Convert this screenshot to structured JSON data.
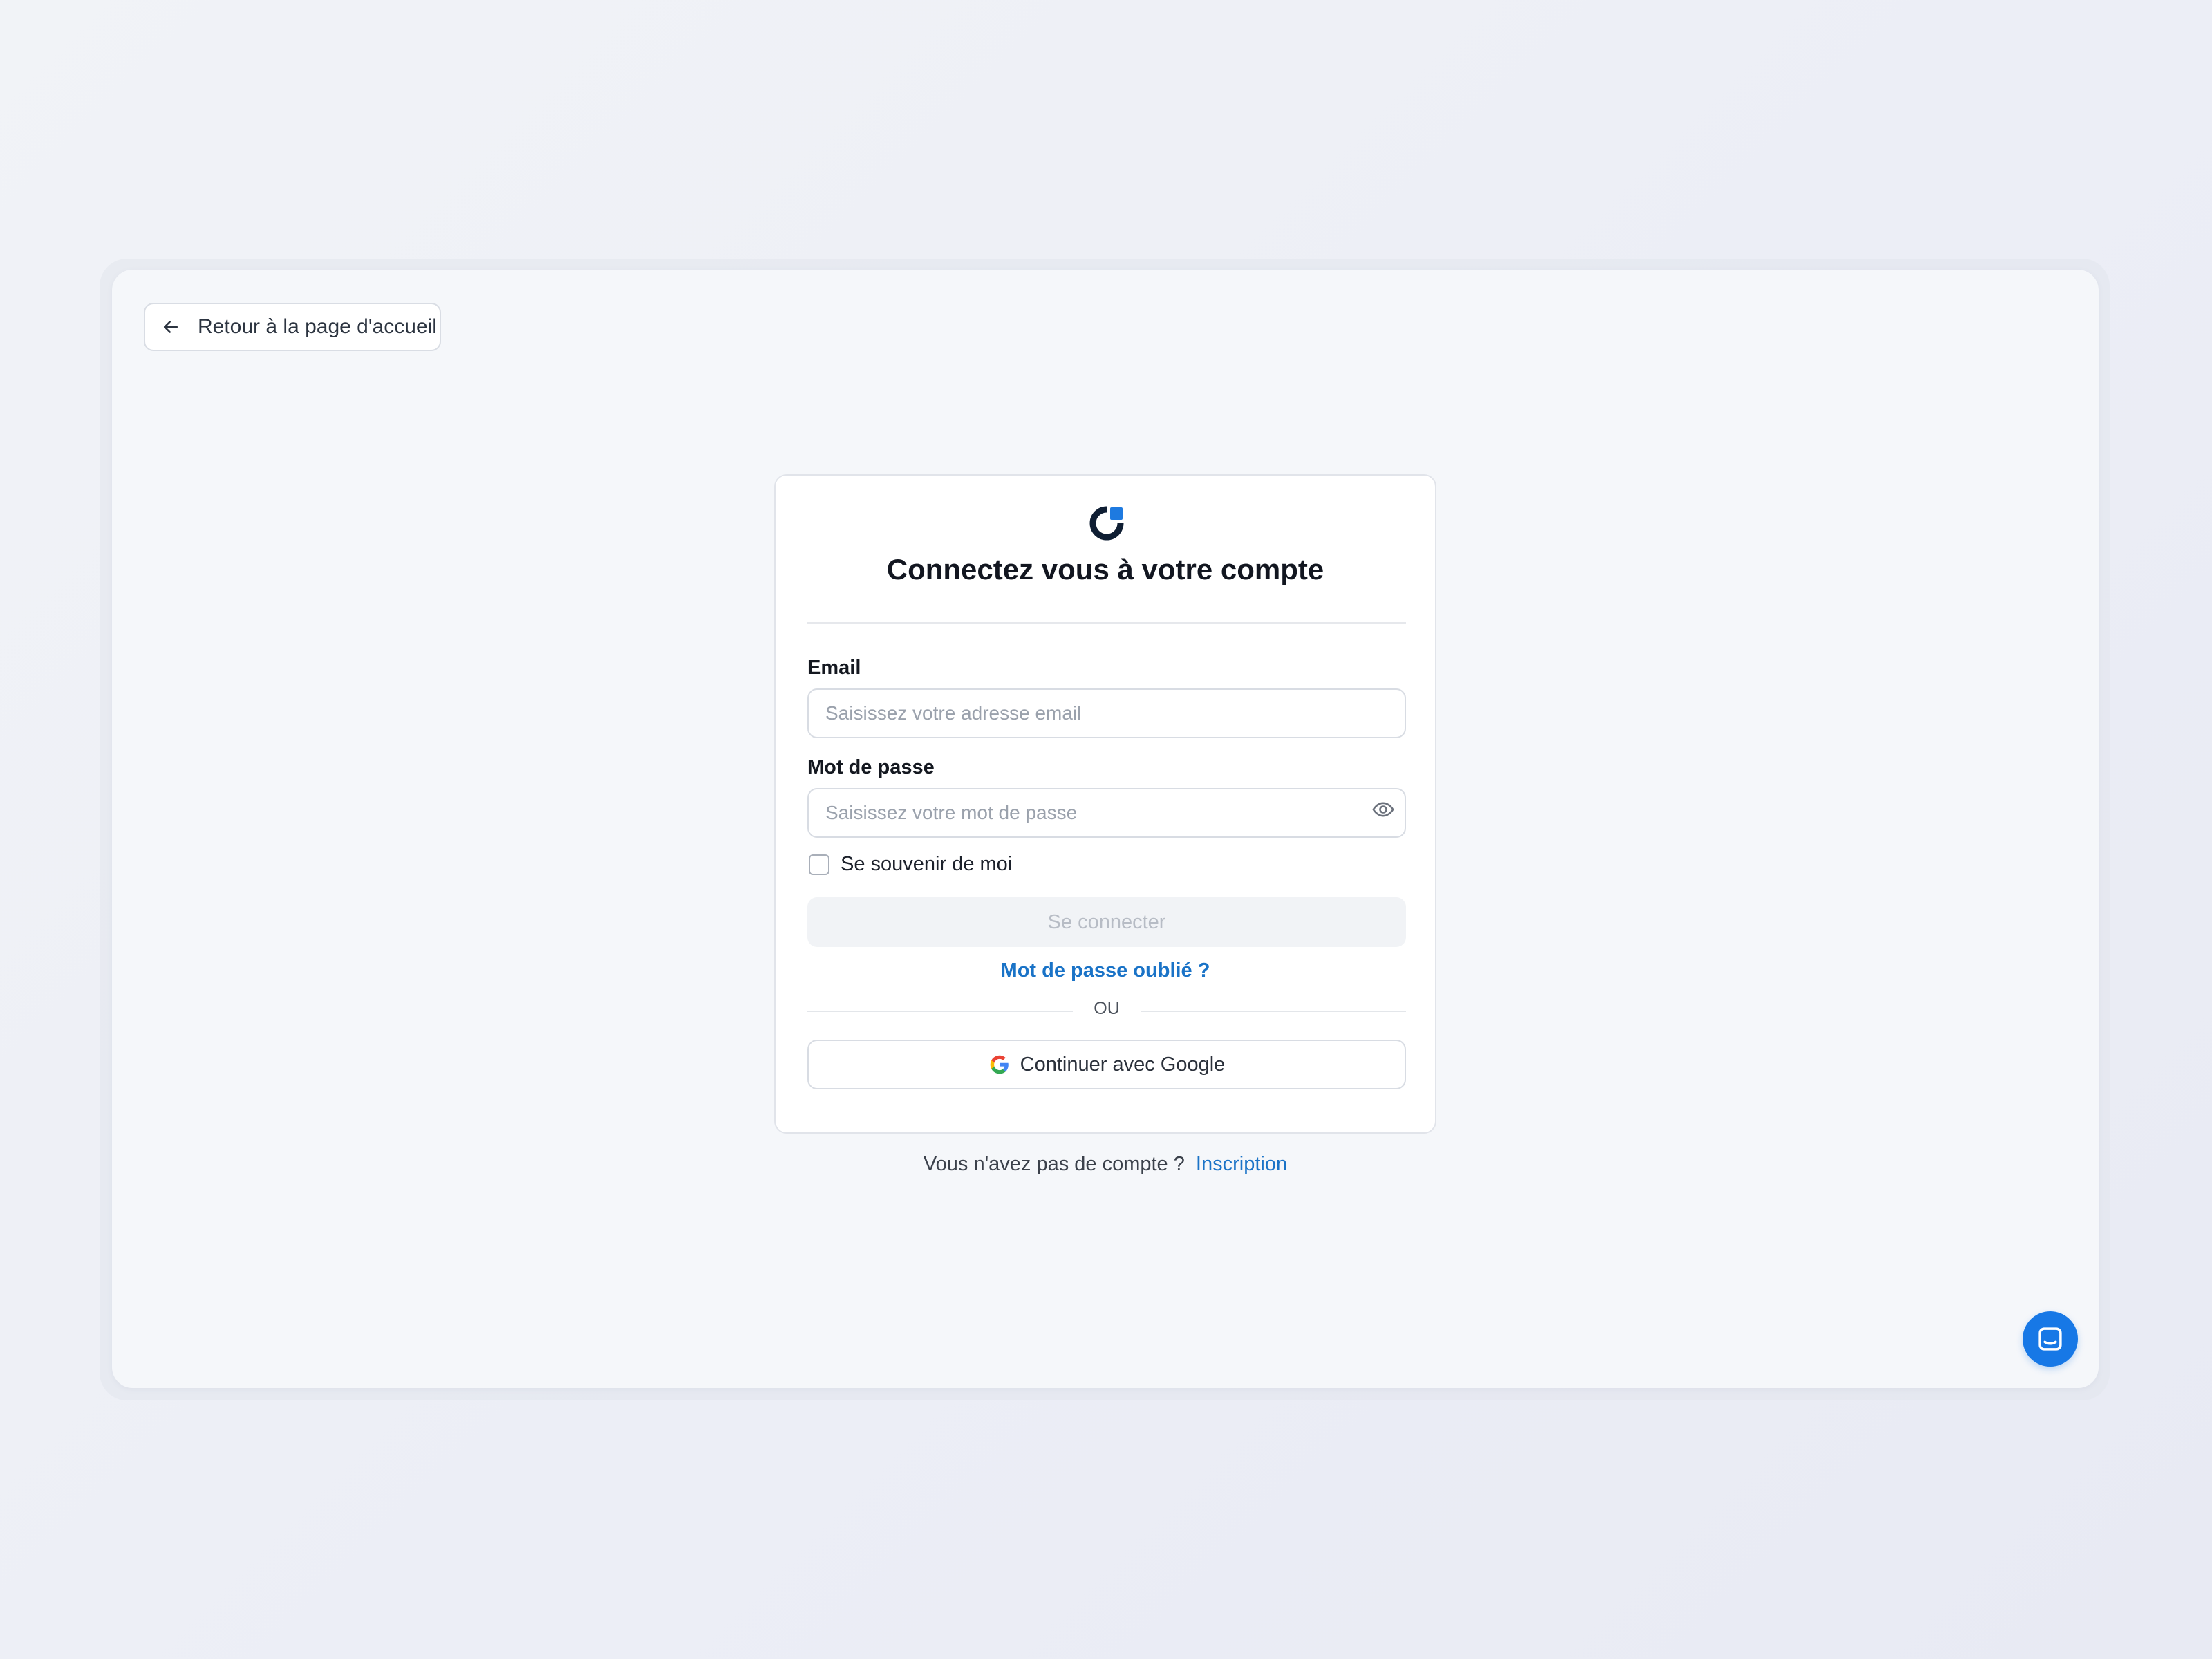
{
  "back_button": {
    "label": "Retour à la page d'accueil",
    "icon": "arrow-left-icon"
  },
  "login": {
    "title": "Connectez vous à votre compte",
    "logo_icon": "brand-logo-icon",
    "email": {
      "label": "Email",
      "placeholder": "Saisissez votre adresse email",
      "value": ""
    },
    "password": {
      "label": "Mot de passe",
      "placeholder": "Saisissez votre mot de passe",
      "value": "",
      "toggle_icon": "eye-icon"
    },
    "remember_label": "Se souvenir de moi",
    "remember_checked": false,
    "submit_label": "Se connecter",
    "forgot_label": "Mot de passe oublié ?",
    "separator_label": "OU",
    "google_label": "Continuer avec Google",
    "google_icon": "google-icon"
  },
  "signup": {
    "prompt": "Vous n'avez pas de compte ?",
    "link": "Inscription"
  },
  "chat": {
    "icon": "chat-icon"
  },
  "colors": {
    "accent": "#1a73c7",
    "chat": "#1778e6",
    "logo_dark": "#0f1e33",
    "logo_blue": "#1e7ae0"
  }
}
